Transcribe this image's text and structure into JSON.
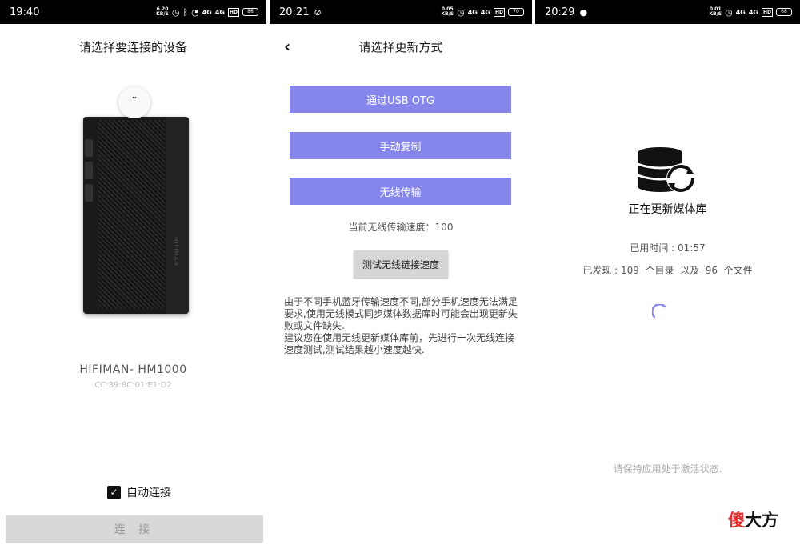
{
  "screen1": {
    "status": {
      "time": "19:40",
      "netspeed_value": "6.20",
      "netspeed_unit": "KB/S",
      "sig1": "4G",
      "sig2": "4G",
      "hd": "HD",
      "battery": "86"
    },
    "title": "请选择要连接的设备",
    "device_name": "HIFIMAN- HM1000",
    "device_mac": "CC:39:8C:01:E1:D2",
    "device_brand": "HIFIMAN",
    "auto_connect_label": "自动连接",
    "auto_connect_checked": true,
    "connect_label": "连 接"
  },
  "screen2": {
    "status": {
      "time": "20:21",
      "netspeed_value": "0.05",
      "netspeed_unit": "KB/S",
      "sig1": "4G",
      "sig2": "4G",
      "hd": "HD",
      "battery": "70"
    },
    "title": "请选择更新方式",
    "buttons": {
      "usb_otg": "通过USB OTG",
      "manual_copy": "手动复制",
      "wireless": "无线传输"
    },
    "speed_text": "当前无线传输速度：100",
    "test_speed_label": "测试无线链接速度",
    "note": "由于不同手机蓝牙传输速度不同,部分手机速度无法满足要求,使用无线模式同步媒体数据库时可能会出现更新失败或文件缺失.\n建议您在使用无线更新媒体库前，先进行一次无线连接速度测试,测试结果越小速度越快."
  },
  "screen3": {
    "status": {
      "time": "20:29",
      "netspeed_value": "0.01",
      "netspeed_unit": "KB/S",
      "sig1": "4G",
      "sig2": "4G",
      "hd": "HD",
      "battery": "68"
    },
    "updating_label": "正在更新媒体库",
    "elapsed": "已用时间 : 01:57",
    "found": "已发现 : 109  个目录  以及  96  个文件",
    "keep_active": "请保持应用处于激活状态."
  },
  "watermark": {
    "part1": "傻",
    "part2": "大方"
  },
  "colors": {
    "accent": "#8585ec",
    "statusbar": "#000000",
    "connect_disabled": "#d8d8d8"
  }
}
